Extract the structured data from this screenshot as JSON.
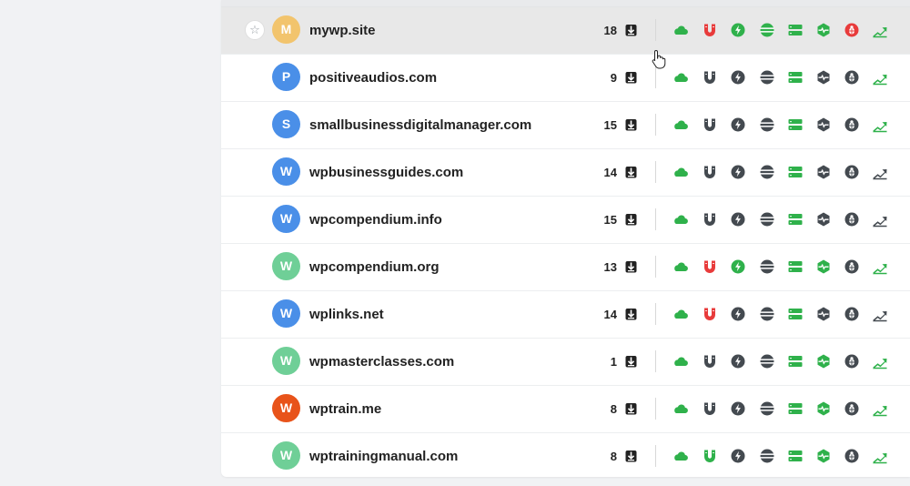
{
  "colors": {
    "ok": "#2fb14b",
    "warn": "#e83b3b",
    "neutral": "#444a50",
    "hover_bg": "#e8e8e8"
  },
  "columns_icons": [
    "cloud-icon",
    "magnet-icon",
    "bolt-icon",
    "bars-icon",
    "server-icon",
    "shield-icon",
    "bug-icon",
    "chart-icon"
  ],
  "sites": [
    {
      "initial": "M",
      "name": "mywp.site",
      "count": "18",
      "avatar_color": "#f2c46d",
      "hover": true,
      "status": [
        "ok",
        "warn",
        "ok",
        "ok",
        "ok",
        "ok",
        "warn",
        "ok"
      ]
    },
    {
      "initial": "P",
      "name": "positiveaudios.com",
      "count": "9",
      "avatar_color": "#4a8fe8",
      "status": [
        "ok",
        "neutral",
        "neutral",
        "neutral",
        "ok",
        "neutral",
        "neutral",
        "ok"
      ]
    },
    {
      "initial": "S",
      "name": "smallbusinessdigitalmanager.com",
      "count": "15",
      "avatar_color": "#4a8fe8",
      "status": [
        "ok",
        "neutral",
        "neutral",
        "neutral",
        "ok",
        "neutral",
        "neutral",
        "ok"
      ]
    },
    {
      "initial": "W",
      "name": "wpbusinessguides.com",
      "count": "14",
      "avatar_color": "#4a8fe8",
      "status": [
        "ok",
        "neutral",
        "neutral",
        "neutral",
        "ok",
        "neutral",
        "neutral",
        "neutral"
      ]
    },
    {
      "initial": "W",
      "name": "wpcompendium.info",
      "count": "15",
      "avatar_color": "#4a8fe8",
      "status": [
        "ok",
        "neutral",
        "neutral",
        "neutral",
        "ok",
        "neutral",
        "neutral",
        "neutral"
      ]
    },
    {
      "initial": "W",
      "name": "wpcompendium.org",
      "count": "13",
      "avatar_color": "#6fcf97",
      "status": [
        "ok",
        "warn",
        "ok",
        "neutral",
        "ok",
        "ok",
        "neutral",
        "ok"
      ]
    },
    {
      "initial": "W",
      "name": "wplinks.net",
      "count": "14",
      "avatar_color": "#4a8fe8",
      "status": [
        "ok",
        "warn",
        "neutral",
        "neutral",
        "ok",
        "neutral",
        "neutral",
        "neutral"
      ]
    },
    {
      "initial": "W",
      "name": "wpmasterclasses.com",
      "count": "1",
      "avatar_color": "#6fcf97",
      "status": [
        "ok",
        "neutral",
        "neutral",
        "neutral",
        "ok",
        "ok",
        "neutral",
        "ok"
      ]
    },
    {
      "initial": "W",
      "name": "wptrain.me",
      "count": "8",
      "avatar_color": "#e8531a",
      "status": [
        "ok",
        "neutral",
        "neutral",
        "neutral",
        "ok",
        "ok",
        "neutral",
        "ok"
      ]
    },
    {
      "initial": "W",
      "name": "wptrainingmanual.com",
      "count": "8",
      "avatar_color": "#6fcf97",
      "status": [
        "ok",
        "ok",
        "neutral",
        "neutral",
        "ok",
        "ok",
        "neutral",
        "ok"
      ]
    }
  ]
}
